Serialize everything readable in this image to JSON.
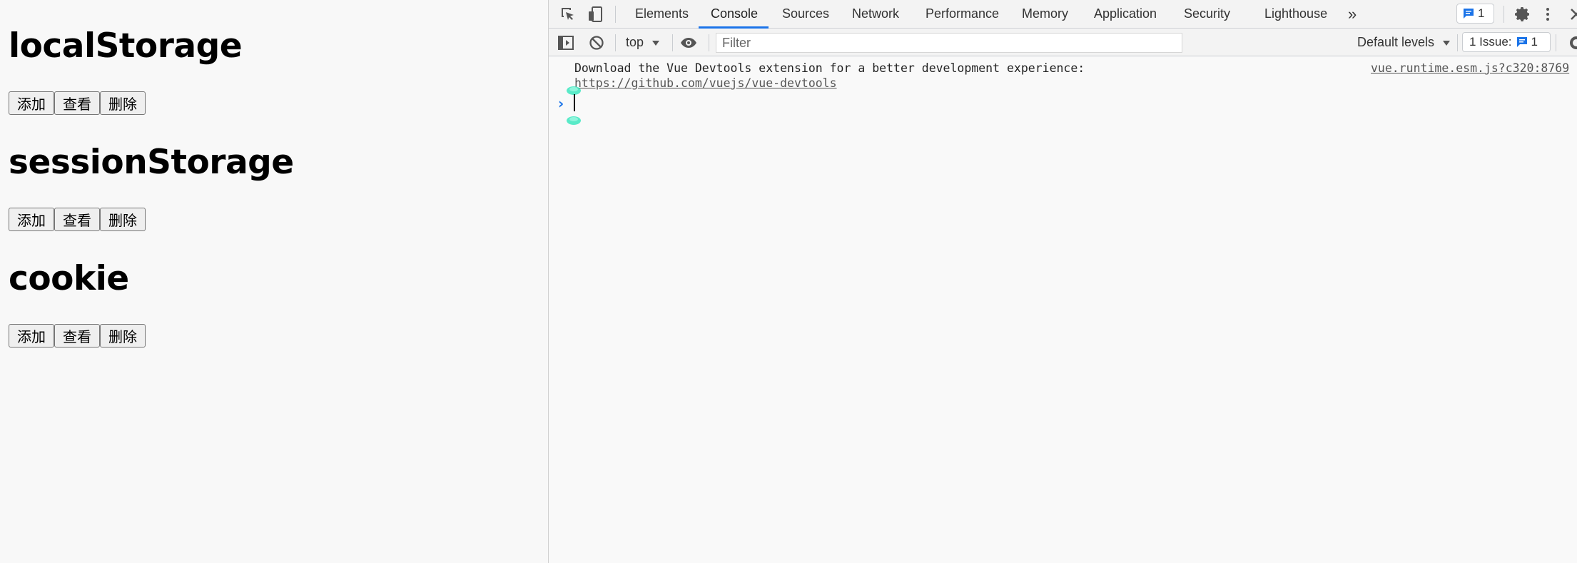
{
  "page": {
    "sections": [
      {
        "title": "localStorage",
        "buttons": [
          "添加",
          "查看",
          "删除"
        ]
      },
      {
        "title": "sessionStorage",
        "buttons": [
          "添加",
          "查看",
          "删除"
        ]
      },
      {
        "title": "cookie",
        "buttons": [
          "添加",
          "查看",
          "删除"
        ]
      }
    ]
  },
  "devtools": {
    "tabs": [
      "Elements",
      "Console",
      "Sources",
      "Network",
      "Performance",
      "Memory",
      "Application",
      "Security",
      "Lighthouse"
    ],
    "active_tab": "Console",
    "more_tabs": "»",
    "messages_count": "1",
    "toolbar": {
      "context": "top",
      "filter_placeholder": "Filter",
      "levels": "Default levels",
      "issues_label": "1 Issue:",
      "issues_count": "1"
    },
    "console": {
      "message_line1": "Download the Vue Devtools extension for a better development experience:",
      "message_link": "https://github.com/vuejs/vue-devtools",
      "source_link": "vue.runtime.esm.js?c320:8769",
      "prompt": "›"
    },
    "colors": {
      "accent": "#1a73e8",
      "cursor_handle": "#3de8c0"
    }
  }
}
